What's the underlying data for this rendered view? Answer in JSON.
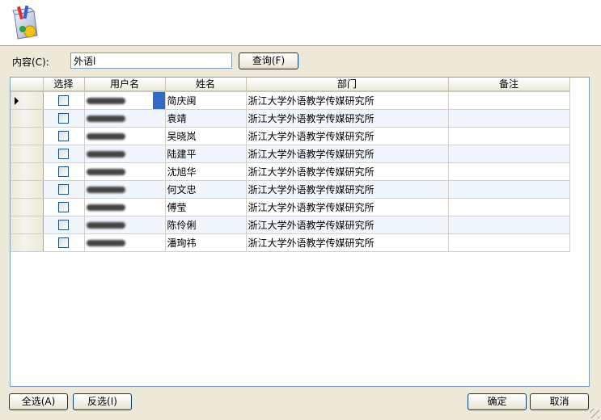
{
  "search": {
    "label": "内容(C):",
    "value": "外语l",
    "query_button": "查询(F)"
  },
  "grid": {
    "columns": [
      "",
      "选择",
      "用户名",
      "姓名",
      "部门",
      "备注"
    ],
    "rows": [
      {
        "name": "简庆闽",
        "department": "浙江大学外语教学传媒研究所",
        "note": "",
        "checked": false,
        "current": true
      },
      {
        "name": "袁靖",
        "department": "浙江大学外语教学传媒研究所",
        "note": "",
        "checked": false,
        "current": false
      },
      {
        "name": "吴晓岚",
        "department": "浙江大学外语教学传媒研究所",
        "note": "",
        "checked": false,
        "current": false
      },
      {
        "name": "陆建平",
        "department": "浙江大学外语教学传媒研究所",
        "note": "",
        "checked": false,
        "current": false
      },
      {
        "name": "沈旭华",
        "department": "浙江大学外语教学传媒研究所",
        "note": "",
        "checked": false,
        "current": false
      },
      {
        "name": "何文忠",
        "department": "浙江大学外语教学传媒研究所",
        "note": "",
        "checked": false,
        "current": false
      },
      {
        "name": "傅莹",
        "department": "浙江大学外语教学传媒研究所",
        "note": "",
        "checked": false,
        "current": false
      },
      {
        "name": "陈伶俐",
        "department": "浙江大学外语教学传媒研究所",
        "note": "",
        "checked": false,
        "current": false
      },
      {
        "name": "潘珣祎",
        "department": "浙江大学外语教学传媒研究所",
        "note": "",
        "checked": false,
        "current": false
      }
    ]
  },
  "footer": {
    "select_all": "全选(A)",
    "invert": "反选(I)",
    "ok": "确定",
    "cancel": "取消"
  }
}
